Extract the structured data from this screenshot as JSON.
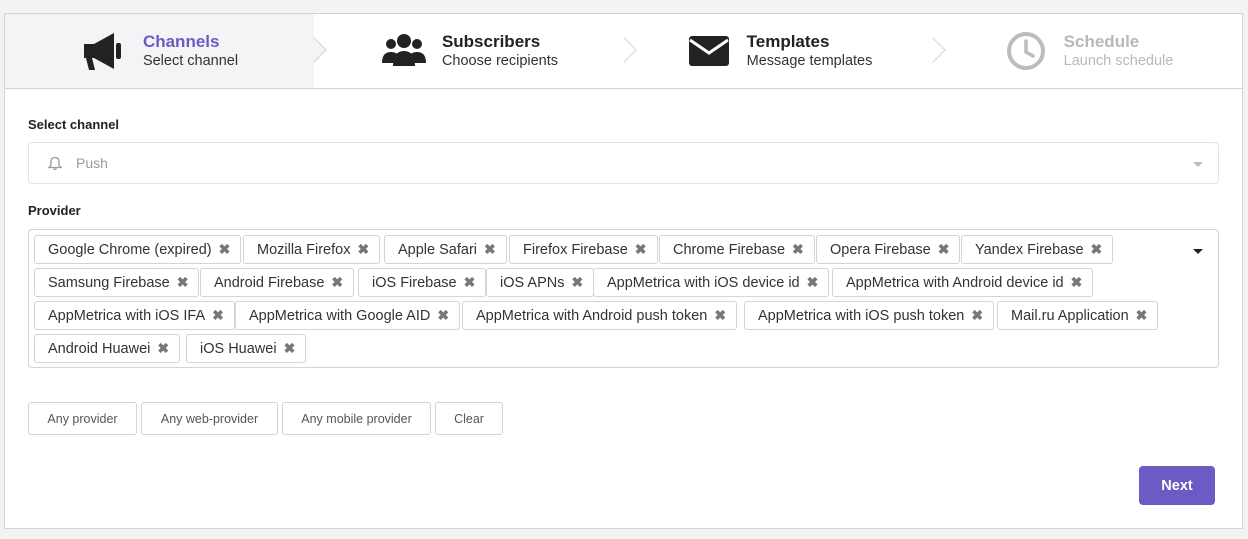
{
  "steps": [
    {
      "title": "Channels",
      "subtitle": "Select channel",
      "icon": "megaphone-icon",
      "state": "active"
    },
    {
      "title": "Subscribers",
      "subtitle": "Choose recipients",
      "icon": "users-icon",
      "state": "normal"
    },
    {
      "title": "Templates",
      "subtitle": "Message templates",
      "icon": "envelope-icon",
      "state": "normal"
    },
    {
      "title": "Schedule",
      "subtitle": "Launch schedule",
      "icon": "clock-icon",
      "state": "disabled"
    }
  ],
  "channel": {
    "label": "Select channel",
    "value": "Push",
    "icon": "bell-icon"
  },
  "provider": {
    "label": "Provider",
    "tags": [
      "Google Chrome (expired)",
      "Mozilla Firefox",
      "Apple Safari",
      "Firefox Firebase",
      "Chrome Firebase",
      "Opera Firebase",
      "Yandex Firebase",
      "Samsung Firebase",
      "Android Firebase",
      "iOS Firebase",
      "iOS APNs",
      "AppMetrica with iOS device id",
      "AppMetrica with Android device id",
      "AppMetrica with iOS IFA",
      "AppMetrica with Google AID",
      "AppMetrica with Android push token",
      "AppMetrica with iOS push token",
      "Mail.ru Application",
      "Android Huawei",
      "iOS Huawei"
    ],
    "remove_glyph": "✖"
  },
  "quick_buttons": [
    "Any provider",
    "Any web-provider",
    "Any mobile provider",
    "Clear"
  ],
  "next_label": "Next",
  "colors": {
    "accent": "#6b5bc4",
    "border": "#d4d4d5"
  }
}
